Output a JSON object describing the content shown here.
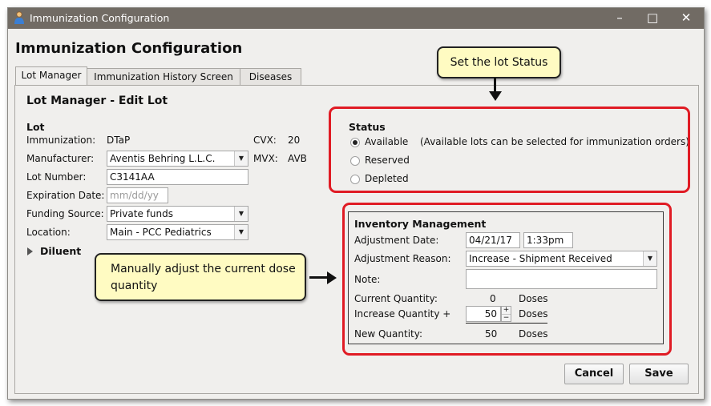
{
  "window": {
    "title": "Immunization Configuration",
    "minimize": "–",
    "maximize": "□",
    "close": "✕"
  },
  "heading": "Immunization Configuration",
  "tabs": [
    {
      "label": "Lot Manager",
      "active": true
    },
    {
      "label": "Immunization History Screen",
      "active": false
    },
    {
      "label": "Diseases",
      "active": false
    }
  ],
  "section_title": "Lot Manager - Edit Lot",
  "lot": {
    "header": "Lot",
    "immunization_label": "Immunization:",
    "immunization_value": "DTaP",
    "cvx_label": "CVX:",
    "cvx_value": "20",
    "manufacturer_label": "Manufacturer:",
    "manufacturer_value": "Aventis Behring L.L.C.",
    "mvx_label": "MVX:",
    "mvx_value": "AVB",
    "lot_number_label": "Lot Number:",
    "lot_number_value": "C3141AA",
    "expiration_label": "Expiration Date:",
    "expiration_placeholder": "mm/dd/yy",
    "funding_label": "Funding Source:",
    "funding_value": "Private funds",
    "location_label": "Location:",
    "location_value": "Main - PCC Pediatrics"
  },
  "diluent": {
    "label": "Diluent"
  },
  "status": {
    "header": "Status",
    "options": [
      {
        "label": "Available",
        "selected": true
      },
      {
        "label": "Reserved",
        "selected": false
      },
      {
        "label": "Depleted",
        "selected": false
      }
    ],
    "available_note": "(Available lots can be selected for immunization orders)"
  },
  "inventory": {
    "header": "Inventory Management",
    "adjustment_date_label": "Adjustment Date:",
    "adjustment_date_value": "04/21/17",
    "adjustment_time_value": "1:33pm",
    "adjustment_reason_label": "Adjustment Reason:",
    "adjustment_reason_value": "Increase - Shipment Received",
    "note_label": "Note:",
    "current_quantity_label": "Current Quantity:",
    "current_quantity_value": "0",
    "increase_quantity_label": "Increase Quantity +",
    "increase_quantity_value": "50",
    "new_quantity_label": "New Quantity:",
    "new_quantity_value": "50",
    "doses": "Doses"
  },
  "buttons": {
    "cancel": "Cancel",
    "save": "Save"
  },
  "callouts": {
    "status": "Set the lot Status",
    "dose": "Manually adjust the current dose quantity"
  },
  "colors": {
    "highlight": "#e01b24",
    "callout_bg": "#fffbc2",
    "titlebar": "#716b64"
  }
}
